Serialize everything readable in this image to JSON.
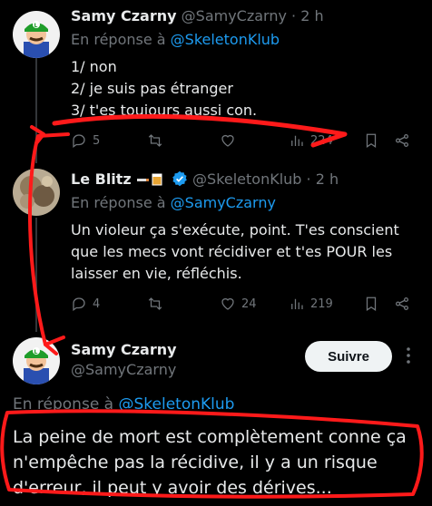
{
  "tweet1": {
    "display_name": "Samy Czarny",
    "handle": "@SamyCzarny",
    "separator": "·",
    "time": "2 h",
    "reply_prefix": "En réponse à",
    "reply_to": "@SkeletonKlub",
    "lines": [
      "1/ non",
      "2/ je suis pas étranger",
      "3/ t'es toujours aussi con."
    ],
    "actions": {
      "replies": "5",
      "retweets": "",
      "likes": "",
      "views": "224"
    }
  },
  "tweet2": {
    "display_name": "Le Blitz",
    "handle": "@SkeletonKlub",
    "separator": "·",
    "time": "2 h",
    "reply_prefix": "En réponse à",
    "reply_to": "@SamyCzarny",
    "text": "Un violeur ça s'exécute, point. T'es conscient que les mecs vont récidiver et t'es POUR les laisser en vie, réfléchis.",
    "actions": {
      "replies": "4",
      "retweets": "",
      "likes": "24",
      "views": "219"
    }
  },
  "tweet3": {
    "display_name": "Samy Czarny",
    "handle": "@SamyCzarny",
    "follow_label": "Suivre",
    "reply_prefix": "En réponse à",
    "reply_to": "@SkeletonKlub",
    "text": "La peine de mort est complètement conne ça n'empêche pas la récidive, il y a un risque d'erreur, il peut y avoir des dérives..."
  },
  "colors": {
    "background": "#000000",
    "text": "#e7e9ea",
    "muted": "#71767b",
    "link": "#1d9bf0",
    "annotation": "#ff1a1a"
  },
  "icons": [
    "reply-icon",
    "retweet-icon",
    "like-icon",
    "views-icon",
    "bookmark-icon",
    "share-icon",
    "verified-badge-icon",
    "blitz-emoji-icon"
  ]
}
